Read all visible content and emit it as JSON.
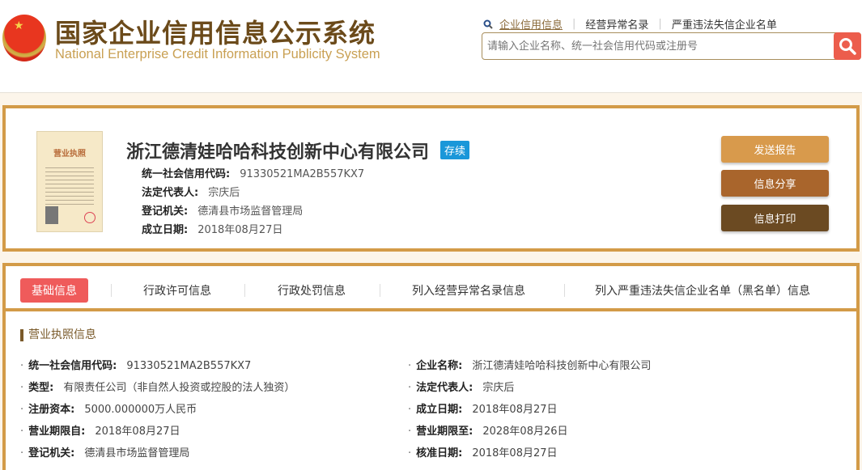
{
  "header": {
    "title_cn": "国家企业信用信息公示系统",
    "title_en": "National Enterprise Credit Information Publicity System",
    "nav": [
      "企业信用信息",
      "经营异常名录",
      "严重违法失信企业名单"
    ],
    "search_placeholder": "请输入企业名称、统一社会信用代码或注册号"
  },
  "card": {
    "license_image_text": "营业执照",
    "company_name": "浙江德清娃哈哈科技创新中心有限公司",
    "status": "存续",
    "fields": [
      {
        "label": "统一社会信用代码:",
        "value": "91330521MA2B557KX7"
      },
      {
        "label": "法定代表人:",
        "value": "宗庆后"
      },
      {
        "label": "登记机关:",
        "value": "德清县市场监督管理局"
      },
      {
        "label": "成立日期:",
        "value": "2018年08月27日"
      }
    ],
    "buttons": [
      "发送报告",
      "信息分享",
      "信息打印"
    ]
  },
  "tabs": [
    "基础信息",
    "行政许可信息",
    "行政处罚信息",
    "列入经营异常名录信息",
    "列入严重违法失信企业名单（黑名单）信息"
  ],
  "section": {
    "title": "营业执照信息",
    "left": [
      {
        "label": "统一社会信用代码:",
        "value": "91330521MA2B557KX7"
      },
      {
        "label": "类型:",
        "value": "有限责任公司（非自然人投资或控股的法人独资）"
      },
      {
        "label": "注册资本:",
        "value": "5000.000000万人民币"
      },
      {
        "label": "营业期限自:",
        "value": "2018年08月27日"
      },
      {
        "label": "登记机关:",
        "value": "德清县市场监督管理局"
      }
    ],
    "right": [
      {
        "label": "企业名称:",
        "value": "浙江德清娃哈哈科技创新中心有限公司"
      },
      {
        "label": "法定代表人:",
        "value": "宗庆后"
      },
      {
        "label": "成立日期:",
        "value": "2018年08月27日"
      },
      {
        "label": "营业期限至:",
        "value": "2028年08月26日"
      },
      {
        "label": "核准日期:",
        "value": "2018年08月27日"
      }
    ]
  }
}
